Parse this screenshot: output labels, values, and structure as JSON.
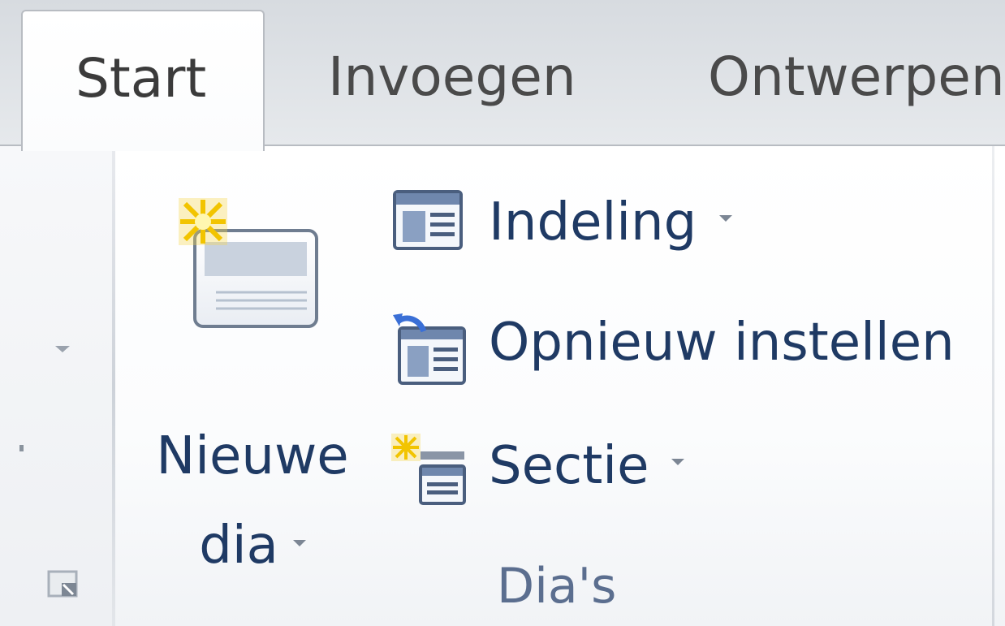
{
  "tabs": [
    {
      "label": "Start",
      "active": true
    },
    {
      "label": "Invoegen",
      "active": false
    },
    {
      "label": "Ontwerpen",
      "active": false
    }
  ],
  "group": {
    "name": "Dia's",
    "new_slide": {
      "line1": "Nieuwe",
      "line2": "dia",
      "icon": "new-slide-icon"
    },
    "buttons": [
      {
        "label": "Indeling",
        "icon": "layout-icon",
        "has_dropdown": true
      },
      {
        "label": "Opnieuw instellen",
        "icon": "reset-slide-icon",
        "has_dropdown": false
      },
      {
        "label": "Sectie",
        "icon": "section-icon",
        "has_dropdown": true
      }
    ]
  },
  "colors": {
    "label_text": "#1f3a64",
    "tab_text": "#4a4a4a",
    "group_label": "#5b6e8f",
    "sparkle": "#f3c400"
  }
}
